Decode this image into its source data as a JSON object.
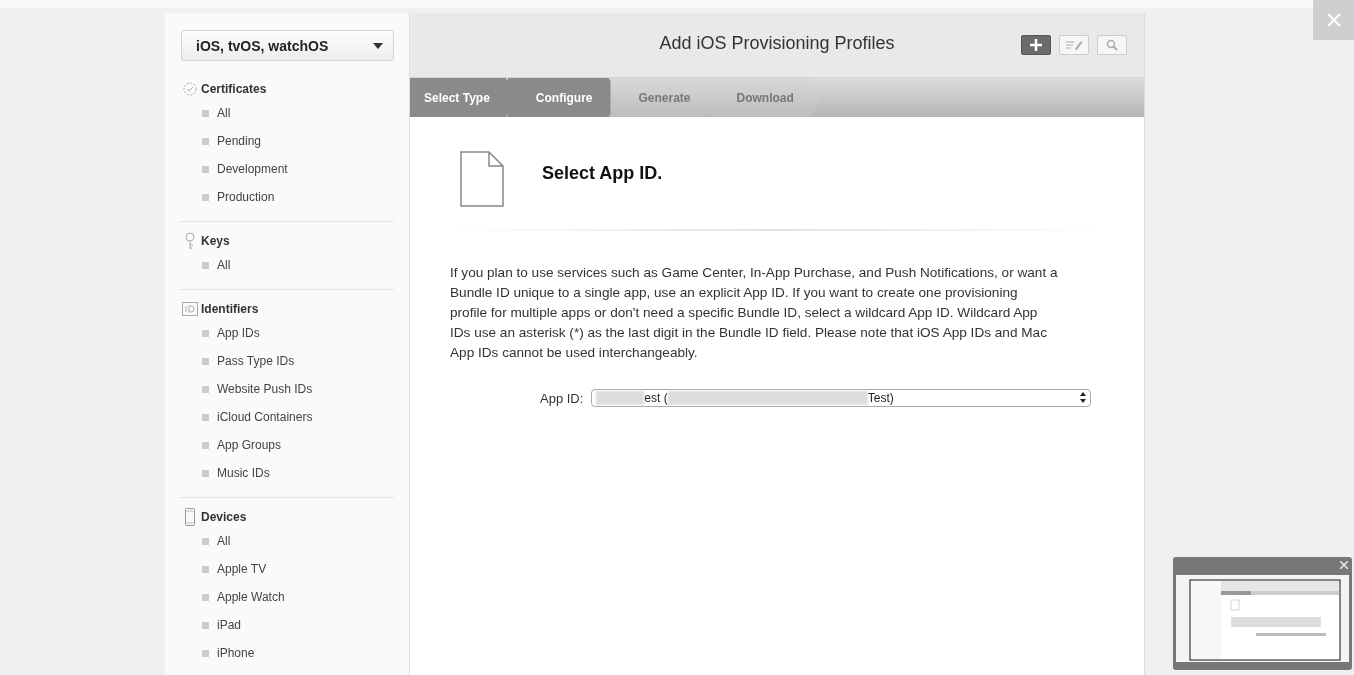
{
  "platform_menu": {
    "value": "iOS, tvOS, watchOS"
  },
  "sidebar": {
    "sections": [
      {
        "title": "Certificates",
        "kind": "gear",
        "items": [
          "All",
          "Pending",
          "Development",
          "Production"
        ]
      },
      {
        "title": "Keys",
        "kind": "key",
        "items": [
          "All"
        ]
      },
      {
        "title": "Identifiers",
        "kind": "id",
        "items": [
          "App IDs",
          "Pass Type IDs",
          "Website Push IDs",
          "iCloud Containers",
          "App Groups",
          "Music IDs"
        ]
      },
      {
        "title": "Devices",
        "kind": "phone",
        "items": [
          "All",
          "Apple TV",
          "Apple Watch",
          "iPad",
          "iPhone"
        ]
      }
    ]
  },
  "header": {
    "title": "Add iOS Provisioning Profiles",
    "tools": [
      {
        "kind": "add",
        "selected": true
      },
      {
        "kind": "edit",
        "selected": false
      },
      {
        "kind": "search",
        "selected": false
      }
    ]
  },
  "steps": [
    {
      "label": "Select Type",
      "completed": true
    },
    {
      "label": "Configure",
      "completed": true
    },
    {
      "label": "Generate",
      "completed": false
    },
    {
      "label": "Download",
      "completed": false
    }
  ],
  "content": {
    "heading": "Select App ID.",
    "description": "If you plan to use services such as Game Center, In-App Purchase, and Push Notifications, or want a Bundle ID unique to a single app, use an explicit App ID. If you want to create one provisioning profile for multiple apps or don't need a specific Bundle ID, select a wildcard App ID. Wildcard App IDs use an asterisk (*) as the last digit in the Bundle ID field. Please note that iOS App IDs and Mac App IDs cannot be used interchangeably.",
    "app_id": {
      "label": "App ID:",
      "value_parts": [
        "est (",
        "Test)"
      ]
    }
  }
}
